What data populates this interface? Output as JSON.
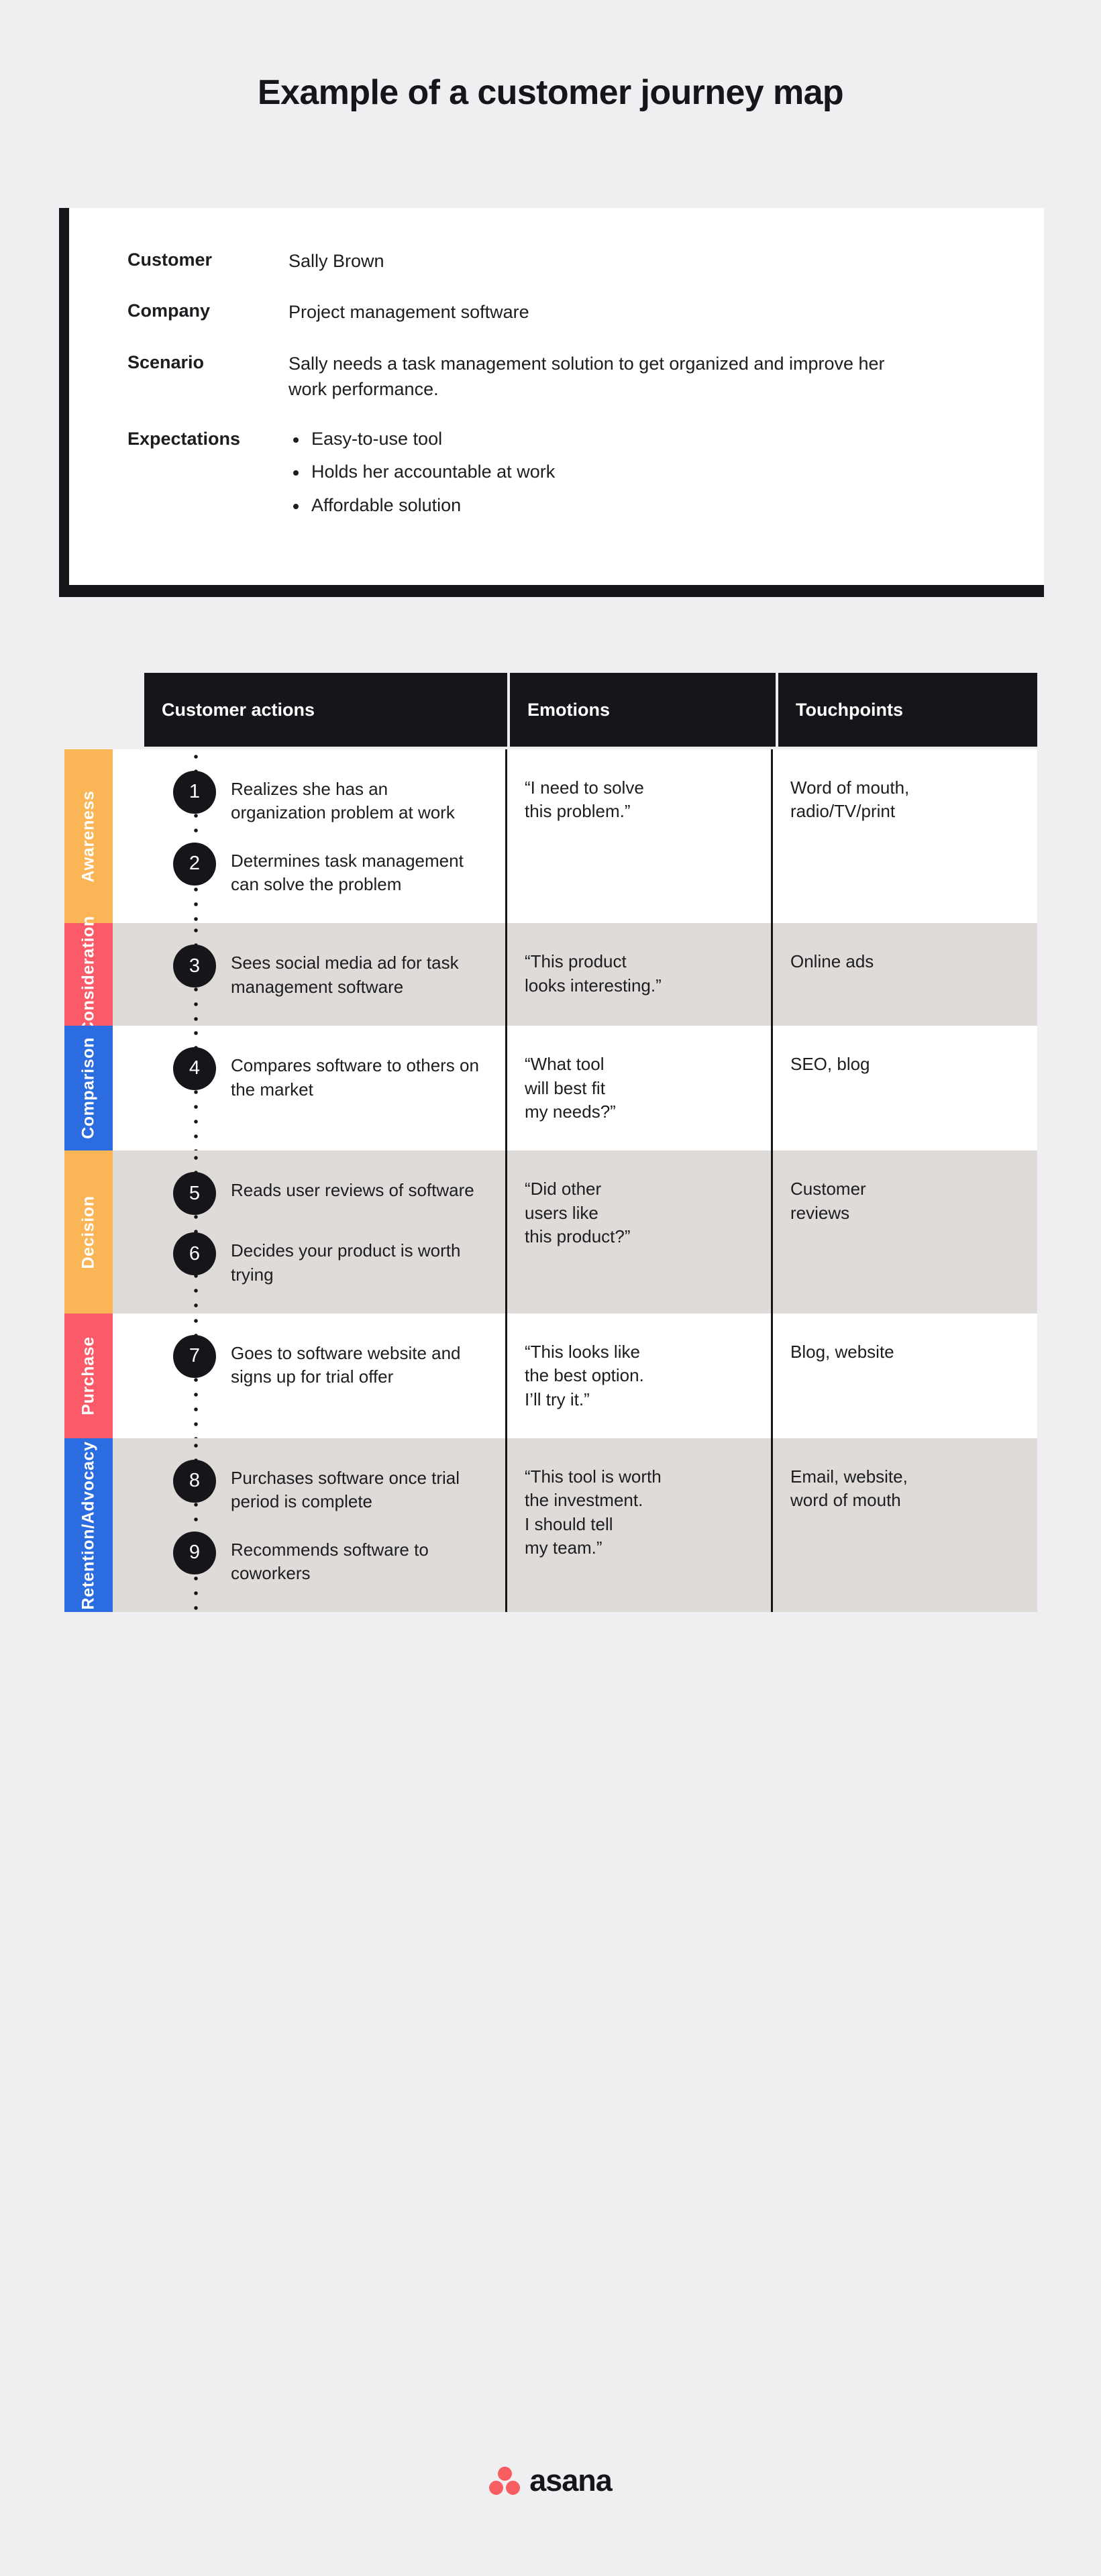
{
  "title": "Example of a customer journey map",
  "persona_card": {
    "rows": [
      {
        "label": "Customer",
        "value": "Sally Brown"
      },
      {
        "label": "Company",
        "value": "Project management software"
      },
      {
        "label": "Scenario",
        "value": "Sally needs a task management solution to get organized and improve her work performance."
      }
    ],
    "expectations_label": "Expectations",
    "expectations": [
      "Easy-to-use tool",
      "Holds her accountable at work",
      "Affordable solution"
    ]
  },
  "table": {
    "headers": [
      "Customer actions",
      "Emotions",
      "Touchpoints"
    ],
    "stages": [
      {
        "name": "Awareness",
        "color": "#F9B556",
        "shaded": false,
        "steps": [
          {
            "number": "1",
            "text": "Realizes she has an organization problem at work"
          },
          {
            "number": "2",
            "text": "Determines task management can solve the problem"
          }
        ],
        "emotion": "“I need to solve\nthis problem.”",
        "touchpoint": "Word of mouth,\nradio/TV/print"
      },
      {
        "name": "Consideration",
        "color": "#FB5B68",
        "shaded": true,
        "steps": [
          {
            "number": "3",
            "text": "Sees social media ad for task management software"
          }
        ],
        "emotion": "“This product\nlooks interesting.”",
        "touchpoint": "Online ads"
      },
      {
        "name": "Comparison",
        "color": "#2B6CE0",
        "shaded": false,
        "steps": [
          {
            "number": "4",
            "text": "Compares software to others on the market"
          }
        ],
        "emotion": "“What tool\nwill best fit\nmy needs?”",
        "touchpoint": "SEO, blog"
      },
      {
        "name": "Decision",
        "color": "#F9B556",
        "shaded": true,
        "steps": [
          {
            "number": "5",
            "text": "Reads user reviews of software"
          },
          {
            "number": "6",
            "text": "Decides your product is worth trying"
          }
        ],
        "emotion": "“Did other\nusers like\nthis product?”",
        "touchpoint": "Customer\nreviews"
      },
      {
        "name": "Purchase",
        "color": "#FB5B68",
        "shaded": false,
        "steps": [
          {
            "number": "7",
            "text": "Goes to software website and signs up for trial offer"
          }
        ],
        "emotion": "“This looks like\nthe best option.\nI’ll try it.”",
        "touchpoint": "Blog, website"
      },
      {
        "name": "Retention/Advocacy",
        "color": "#2B6CE0",
        "shaded": true,
        "steps": [
          {
            "number": "8",
            "text": "Purchases software once trial period is complete"
          },
          {
            "number": "9",
            "text": "Recommends software to coworkers"
          }
        ],
        "emotion": "“This tool is worth\nthe investment.\nI should tell\nmy team.”",
        "touchpoint": "Email, website,\nword of mouth"
      }
    ]
  },
  "footer": {
    "brand": "asana",
    "brand_color": "#f85d61"
  },
  "theme": {
    "background": "#efeff1",
    "ink": "#16161a",
    "shaded_row": "#dedbd8"
  }
}
